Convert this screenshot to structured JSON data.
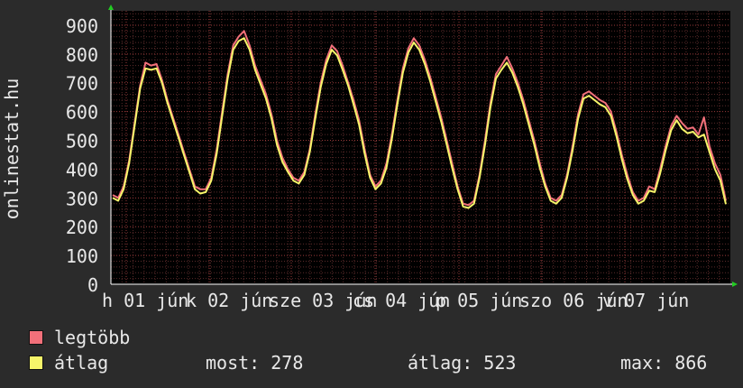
{
  "chart_data": {
    "type": "line",
    "ylabel": "onlinestat.hu",
    "ylim": [
      0,
      950
    ],
    "yticks": [
      0,
      100,
      200,
      300,
      400,
      500,
      600,
      700,
      800,
      900
    ],
    "xtick_labels": [
      "h 01 jún",
      "k 02 jún",
      "sze 03 jún",
      "cs 04 jún",
      "p 05 jún",
      "szo 06 jún",
      "v 07 jún"
    ],
    "grid": true,
    "series": [
      {
        "name": "legtöbb",
        "color": "#f2707a",
        "values": [
          310,
          300,
          340,
          430,
          560,
          690,
          770,
          760,
          765,
          710,
          640,
          580,
          520,
          460,
          400,
          340,
          330,
          330,
          370,
          470,
          600,
          730,
          830,
          860,
          880,
          830,
          760,
          710,
          660,
          590,
          500,
          440,
          400,
          370,
          360,
          390,
          470,
          590,
          700,
          780,
          830,
          810,
          760,
          700,
          640,
          570,
          470,
          380,
          340,
          360,
          420,
          520,
          640,
          750,
          820,
          855,
          830,
          780,
          720,
          650,
          580,
          500,
          420,
          340,
          280,
          275,
          290,
          380,
          500,
          630,
          730,
          760,
          790,
          750,
          700,
          640,
          570,
          500,
          420,
          350,
          300,
          290,
          310,
          380,
          480,
          590,
          660,
          670,
          655,
          640,
          630,
          600,
          530,
          450,
          380,
          320,
          290,
          300,
          340,
          330,
          400,
          480,
          550,
          585,
          560,
          540,
          545,
          520,
          580,
          480,
          420,
          380,
          290
        ]
      },
      {
        "name": "átlag",
        "color": "#f6f56a",
        "values": [
          300,
          290,
          330,
          420,
          550,
          680,
          750,
          745,
          750,
          700,
          630,
          570,
          510,
          450,
          390,
          330,
          315,
          320,
          360,
          455,
          585,
          715,
          815,
          845,
          855,
          815,
          745,
          695,
          645,
          575,
          485,
          425,
          390,
          360,
          350,
          380,
          460,
          575,
          685,
          765,
          815,
          795,
          745,
          690,
          625,
          555,
          455,
          370,
          330,
          350,
          405,
          505,
          625,
          735,
          805,
          840,
          815,
          765,
          705,
          635,
          565,
          485,
          405,
          330,
          270,
          265,
          280,
          370,
          485,
          615,
          715,
          745,
          770,
          735,
          685,
          625,
          555,
          485,
          405,
          340,
          290,
          280,
          300,
          370,
          465,
          575,
          645,
          655,
          640,
          625,
          615,
          585,
          515,
          435,
          365,
          310,
          280,
          290,
          325,
          320,
          385,
          465,
          535,
          570,
          540,
          525,
          530,
          510,
          520,
          460,
          400,
          360,
          278
        ]
      }
    ]
  },
  "legend": [
    {
      "label": "legtöbb",
      "color": "#f2707a"
    },
    {
      "label": "átlag",
      "color": "#f6f56a"
    }
  ],
  "stats": {
    "most": "most: 278",
    "atlag": "átlag: 523",
    "max": "max: 866"
  }
}
